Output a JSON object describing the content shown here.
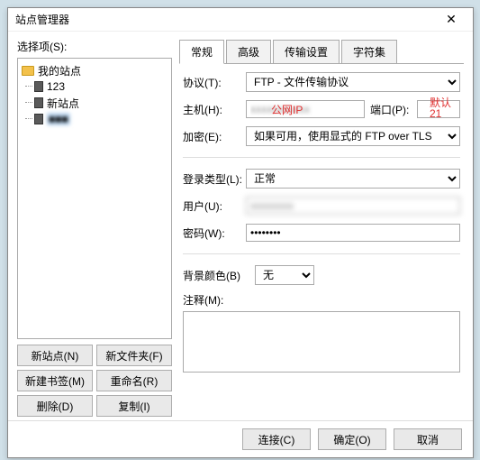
{
  "window": {
    "title": "站点管理器"
  },
  "left": {
    "select_label": "选择项(S):",
    "root": "我的站点",
    "items": [
      "123",
      "新站点",
      "■■■"
    ]
  },
  "buttons": {
    "new_site": "新站点(N)",
    "new_folder": "新文件夹(F)",
    "new_bookmark": "新建书签(M)",
    "rename": "重命名(R)",
    "delete": "删除(D)",
    "copy": "复制(I)"
  },
  "tabs": [
    "常规",
    "高级",
    "传输设置",
    "字符集"
  ],
  "form": {
    "protocol_label": "协议(T):",
    "protocol_value": "FTP - 文件传输协议",
    "host_label": "主机(H):",
    "host_overlay": "公网IP",
    "host_value": "xxxxxxxxxxx",
    "port_label": "端口(P):",
    "port_value": "",
    "port_note1": "默认",
    "port_note2": "21",
    "encrypt_label": "加密(E):",
    "encrypt_value": "如果可用，使用显式的 FTP over TLS",
    "login_type_label": "登录类型(L):",
    "login_type_value": "正常",
    "user_label": "用户(U):",
    "user_value": "xxxxxxxx",
    "password_label": "密码(W):",
    "password_value": "••••••••",
    "bgcolor_label": "背景颜色(B)",
    "bgcolor_value": "无",
    "comment_label": "注释(M):",
    "comment_value": ""
  },
  "footer": {
    "connect": "连接(C)",
    "ok": "确定(O)",
    "cancel": "取消"
  }
}
